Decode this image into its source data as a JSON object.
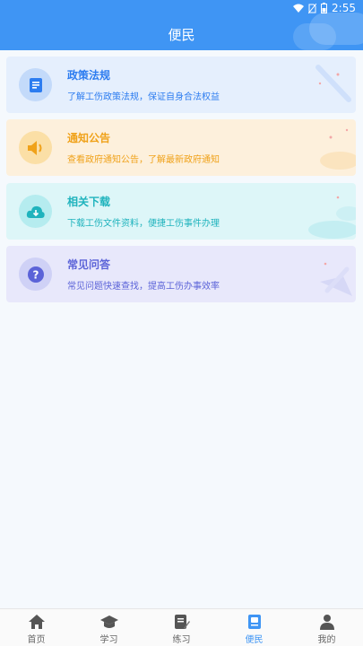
{
  "status_bar": {
    "time": "2:55"
  },
  "header": {
    "title": "便民"
  },
  "cards": [
    {
      "title": "政策法规",
      "desc": "了解工伤政策法规，保证自身合法权益",
      "icon": "document-icon"
    },
    {
      "title": "通知公告",
      "desc": "查看政府通知公告，了解最新政府通知",
      "icon": "speaker-icon"
    },
    {
      "title": "相关下载",
      "desc": "下载工伤文件资料，便捷工伤事件办理",
      "icon": "cloud-download-icon"
    },
    {
      "title": "常见问答",
      "desc": "常见问题快速查找，提高工伤办事效率",
      "icon": "question-icon"
    }
  ],
  "tabbar": {
    "items": [
      {
        "label": "首页",
        "icon": "home-icon"
      },
      {
        "label": "学习",
        "icon": "graduation-cap-icon"
      },
      {
        "label": "练习",
        "icon": "edit-note-icon"
      },
      {
        "label": "便民",
        "icon": "notebook-icon"
      },
      {
        "label": "我的",
        "icon": "user-icon"
      }
    ],
    "active_index": 3
  },
  "colors": {
    "header_bg": "#3f95f4",
    "active_tab": "#3f95f4",
    "inactive_tab": "#666666",
    "policy_accent": "#2c7cf0",
    "notice_accent": "#f0a21a",
    "download_accent": "#1fb3bd",
    "faq_accent": "#5b63d8"
  }
}
